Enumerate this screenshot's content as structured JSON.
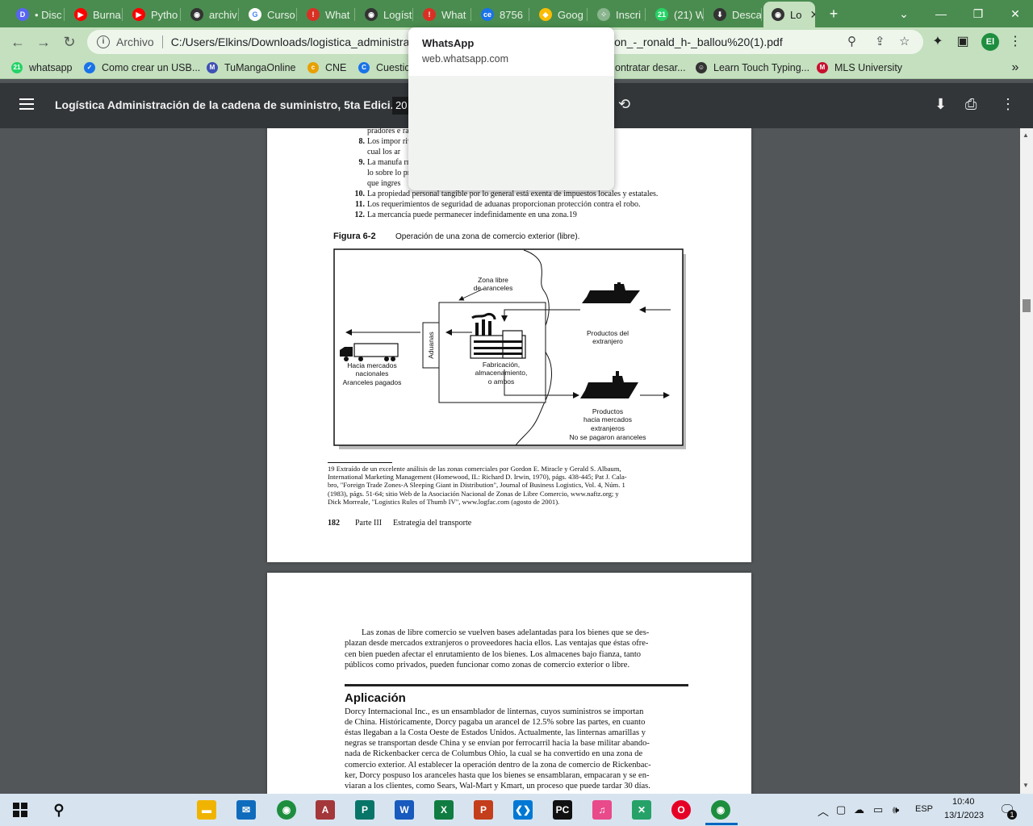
{
  "browser": {
    "tabs": [
      {
        "label": "• Disc",
        "icon": "discord-icon",
        "color": "#5865f2",
        "glyph": "D"
      },
      {
        "label": "Burna",
        "icon": "youtube-icon",
        "color": "#ff0000",
        "glyph": "▶"
      },
      {
        "label": "Pytho",
        "icon": "youtube-icon",
        "color": "#ff0000",
        "glyph": "▶"
      },
      {
        "label": "archiv",
        "icon": "globe-icon",
        "color": "#333333",
        "glyph": "◉"
      },
      {
        "label": "Curso",
        "icon": "google-icon",
        "color": "#ffffff",
        "glyph": "G"
      },
      {
        "label": "What",
        "icon": "warning-icon",
        "color": "#d93025",
        "glyph": "!"
      },
      {
        "label": "Logíst",
        "icon": "globe-icon",
        "color": "#333333",
        "glyph": "◉"
      },
      {
        "label": "What",
        "icon": "warning-icon",
        "color": "#d93025",
        "glyph": "!"
      },
      {
        "label": "8756",
        "icon": "ce-icon",
        "color": "#1a73e8",
        "glyph": "ce"
      },
      {
        "label": "Goog",
        "icon": "maps-icon",
        "color": "#fbbc04",
        "glyph": "◆"
      },
      {
        "label": "Inscri",
        "icon": "dots-icon",
        "color": "#8ab58e",
        "glyph": "⁘"
      },
      {
        "label": "(21) W",
        "icon": "whatsapp-icon",
        "color": "#25d366",
        "glyph": "21"
      },
      {
        "label": "Desca",
        "icon": "download-icon",
        "color": "#333333",
        "glyph": "⬇"
      },
      {
        "label": "Lo",
        "icon": "globe-icon",
        "color": "#333333",
        "glyph": "◉"
      }
    ],
    "new_tab": "+",
    "address": {
      "scheme": "Archivo",
      "url_left": "C:/Users/Elkins/Downloads/logistica_administrac",
      "url_right": "ion_-_ronald_h-_ballou%20(1).pdf"
    },
    "profile_initials": "El",
    "bookmarks": [
      {
        "label": "whatsapp",
        "icon": "whatsapp-icon",
        "color": "#25d366",
        "glyph": "21"
      },
      {
        "label": "Como crear un USB...",
        "icon": "check-icon",
        "color": "#1a73e8",
        "glyph": "✓"
      },
      {
        "label": "TuMangaOnline",
        "icon": "manga-icon",
        "color": "#3f51b5",
        "glyph": "M"
      },
      {
        "label": "CNE",
        "icon": "cne-icon",
        "color": "#e8a000",
        "glyph": "c"
      },
      {
        "label": "Cuestic",
        "icon": "ce-icon",
        "color": "#1a73e8",
        "glyph": "C"
      },
      {
        "label": "ontratar desar...",
        "icon": "",
        "color": "",
        "glyph": ""
      },
      {
        "label": "Learn Touch Typing...",
        "icon": "typing-icon",
        "color": "#333333",
        "glyph": "☺"
      },
      {
        "label": "MLS University",
        "icon": "mls-icon",
        "color": "#c8102e",
        "glyph": "M"
      }
    ],
    "popup": {
      "title": "WhatsApp",
      "url": "web.whatsapp.com"
    }
  },
  "pdf": {
    "title": "Logística Administración de la cadena de suministro, 5ta Edici...",
    "page_number": "20"
  },
  "page1": {
    "list_lines": [
      {
        "num": "",
        "text": "pradores e                                                                        ra la entrega."
      },
      {
        "num": "8.",
        "text": "Los impor                                                                      rivilegiado gracias al"
      },
      {
        "num": "",
        "text": "cual los ar"
      },
      {
        "num": "9.",
        "text": "La manufa                                                                       rrirá en aranceles só-"
      },
      {
        "num": "",
        "text": "lo sobre lo                                                                        producto terminado"
      },
      {
        "num": "",
        "text": "que ingres"
      },
      {
        "num": "10.",
        "text": "La propiedad personal tangible por lo general está exenta de impuestos locales y estatales."
      },
      {
        "num": "11.",
        "text": "Los requerimientos de seguridad de aduanas proporcionan protección contra el robo."
      },
      {
        "num": "12.",
        "text": "La mercancía puede permanecer indefinidamente en una zona.19"
      }
    ],
    "figure_label": "Figura 6-2",
    "figure_caption": "Operación de una zona de comercio exterior (libre).",
    "diagram": {
      "zona_libre": [
        "Zona libre",
        "de aranceles"
      ],
      "aduanas": "Aduanas",
      "productos_extranjero": [
        "Productos del",
        "extranjero"
      ],
      "fabricacion": [
        "Fabricación,",
        "almacenamiento,",
        "o ambos"
      ],
      "hacia_mercados": [
        "Hacia mercados",
        "nacionales",
        "Aranceles pagados"
      ],
      "productos_mercados": [
        "Productos",
        "hacia mercados",
        "extranjeros",
        "No se pagaron aranceles"
      ]
    },
    "footnote": [
      "19 Extraído de un excelente análisis de las zonas comerciales por Gordon E. Miracle y Gerald S. Albaum,",
      "International Marketing Management (Homewood, IL: Richard D. Irwin, 1970), págs. 438-445; Pat J. Cala-",
      "bro, \"Foreign Trade Zones-A Sleeping Giant in Distribution\", Journal of Business Logistics, Vol. 4, Núm. 1",
      "(1983), págs. 51-64; sitio Web de la Asociación Nacional de Zonas de Libre Comercio, www.naftz.org; y",
      "Dick Morreale, \"Logistics Rules of Thumb IV\", www.logfac.com (agosto de 2001)."
    ],
    "page_num": "182",
    "part": "Parte III",
    "part_title": "Estrategia del transporte"
  },
  "page2": {
    "paragraph": [
      "Las zonas de libre comercio se vuelven bases adelantadas para los bienes que se des-",
      "plazan desde mercados extranjeros o proveedores hacia ellos. Las ventajas que éstas ofre-",
      "cen bien pueden afectar el enrutamiento de los bienes. Los almacenes bajo fianza, tanto",
      "públicos como privados, pueden funcionar como zonas de comercio exterior o libre."
    ],
    "heading": "Aplicación",
    "body": [
      "Dorcy Internacional Inc., es un ensamblador de linternas, cuyos suministros se importan",
      "de China. Históricamente, Dorcy pagaba un arancel de 12.5% sobre las partes, en cuanto",
      "éstas llegaban a la Costa Oeste de Estados Unidos. Actualmente, las linternas amarillas y",
      "negras se transportan desde China y se envían por ferrocarril hacia la base militar abando-",
      "nada de Rickenbacker cerca de Columbus Ohio, la cual se ha convertido en una zona de",
      "comercio exterior. Al establecer la operación dentro de la zona de comercio de Rickenbac-",
      "ker, Dorcy pospuso los aranceles hasta que los bienes se ensamblaran, empacaran y se en-",
      "viaran a los clientes, como Sears, Wal-Mart y Kmart, un proceso que puede tardar 30 días."
    ]
  },
  "taskbar": {
    "apps": [
      {
        "name": "file-explorer",
        "color": "#f0b400",
        "glyph": "▬"
      },
      {
        "name": "mail",
        "color": "#0f6cbd",
        "glyph": "✉"
      },
      {
        "name": "chrome",
        "color": "#1e8e3e",
        "glyph": "◉"
      },
      {
        "name": "access",
        "color": "#a4373a",
        "glyph": "A"
      },
      {
        "name": "publisher",
        "color": "#077568",
        "glyph": "P"
      },
      {
        "name": "word",
        "color": "#185abd",
        "glyph": "W"
      },
      {
        "name": "excel",
        "color": "#107c41",
        "glyph": "X"
      },
      {
        "name": "powerpoint",
        "color": "#c43e1c",
        "glyph": "P"
      },
      {
        "name": "vscode",
        "color": "#0078d4",
        "glyph": "❮❯"
      },
      {
        "name": "pycharm",
        "color": "#111111",
        "glyph": "PC"
      },
      {
        "name": "itunes",
        "color": "#e84a8a",
        "glyph": "♫"
      },
      {
        "name": "tools",
        "color": "#26a269",
        "glyph": "✕"
      },
      {
        "name": "opera",
        "color": "#e60026",
        "glyph": "O"
      },
      {
        "name": "chrome-profile",
        "color": "#1e8e3e",
        "glyph": "◉"
      }
    ],
    "lang": "ESP",
    "time": "10:40",
    "date": "13/1/2023",
    "notifications": "1"
  }
}
